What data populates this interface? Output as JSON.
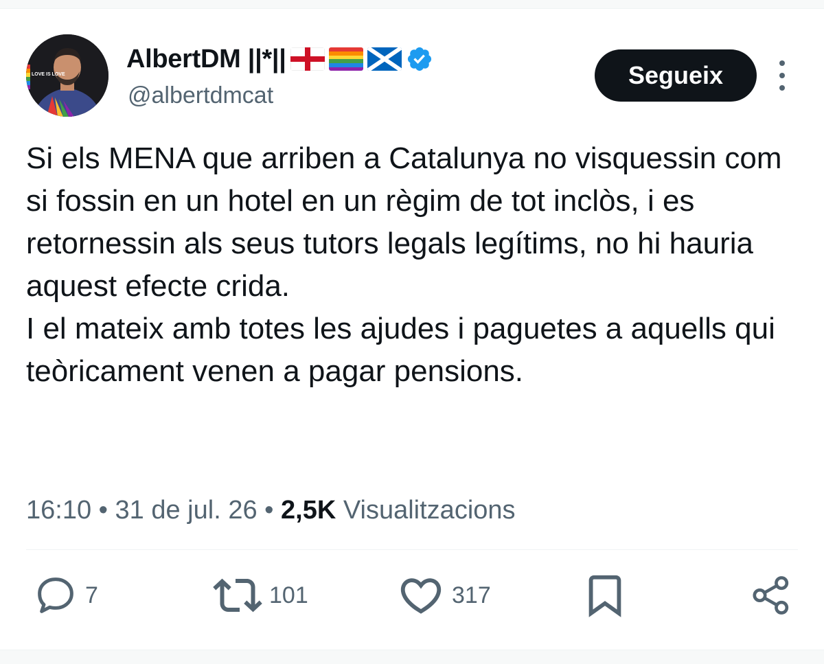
{
  "author": {
    "display_name": "AlbertDM ||*||",
    "handle": "@albertdmcat",
    "avatar_badge": "LOVE IS LOVE",
    "flags": [
      "england-flag",
      "rainbow-flag",
      "scotland-flag"
    ],
    "verified_icon": "verified-badge-icon"
  },
  "follow_label": "Segueix",
  "tweet": {
    "paragraphs": [
      "Si els MENA que arriben a Catalunya no visquessin com si fossin en un hotel en un règim de tot inclòs, i es retornessin als seus tutors legals legítims, no hi hauria aquest efecte crida.",
      "I el mateix amb totes les ajudes i paguetes a aquells qui teòricament venen a pagar pensions."
    ]
  },
  "meta": {
    "time": "16:10",
    "separator": "•",
    "date": "31 de jul. 26",
    "views_count": "2,5K",
    "views_label": "Visualitzacions"
  },
  "actions": {
    "replies": {
      "icon": "reply-icon",
      "count": "7"
    },
    "reposts": {
      "icon": "repost-icon",
      "count": "101"
    },
    "likes": {
      "icon": "heart-icon",
      "count": "317"
    },
    "bookmark": {
      "icon": "bookmark-icon"
    },
    "share": {
      "icon": "share-icon"
    }
  },
  "colors": {
    "text": "#0f1419",
    "secondary": "#536471",
    "verified": "#1d9bf0",
    "button_bg": "#0f1419"
  }
}
